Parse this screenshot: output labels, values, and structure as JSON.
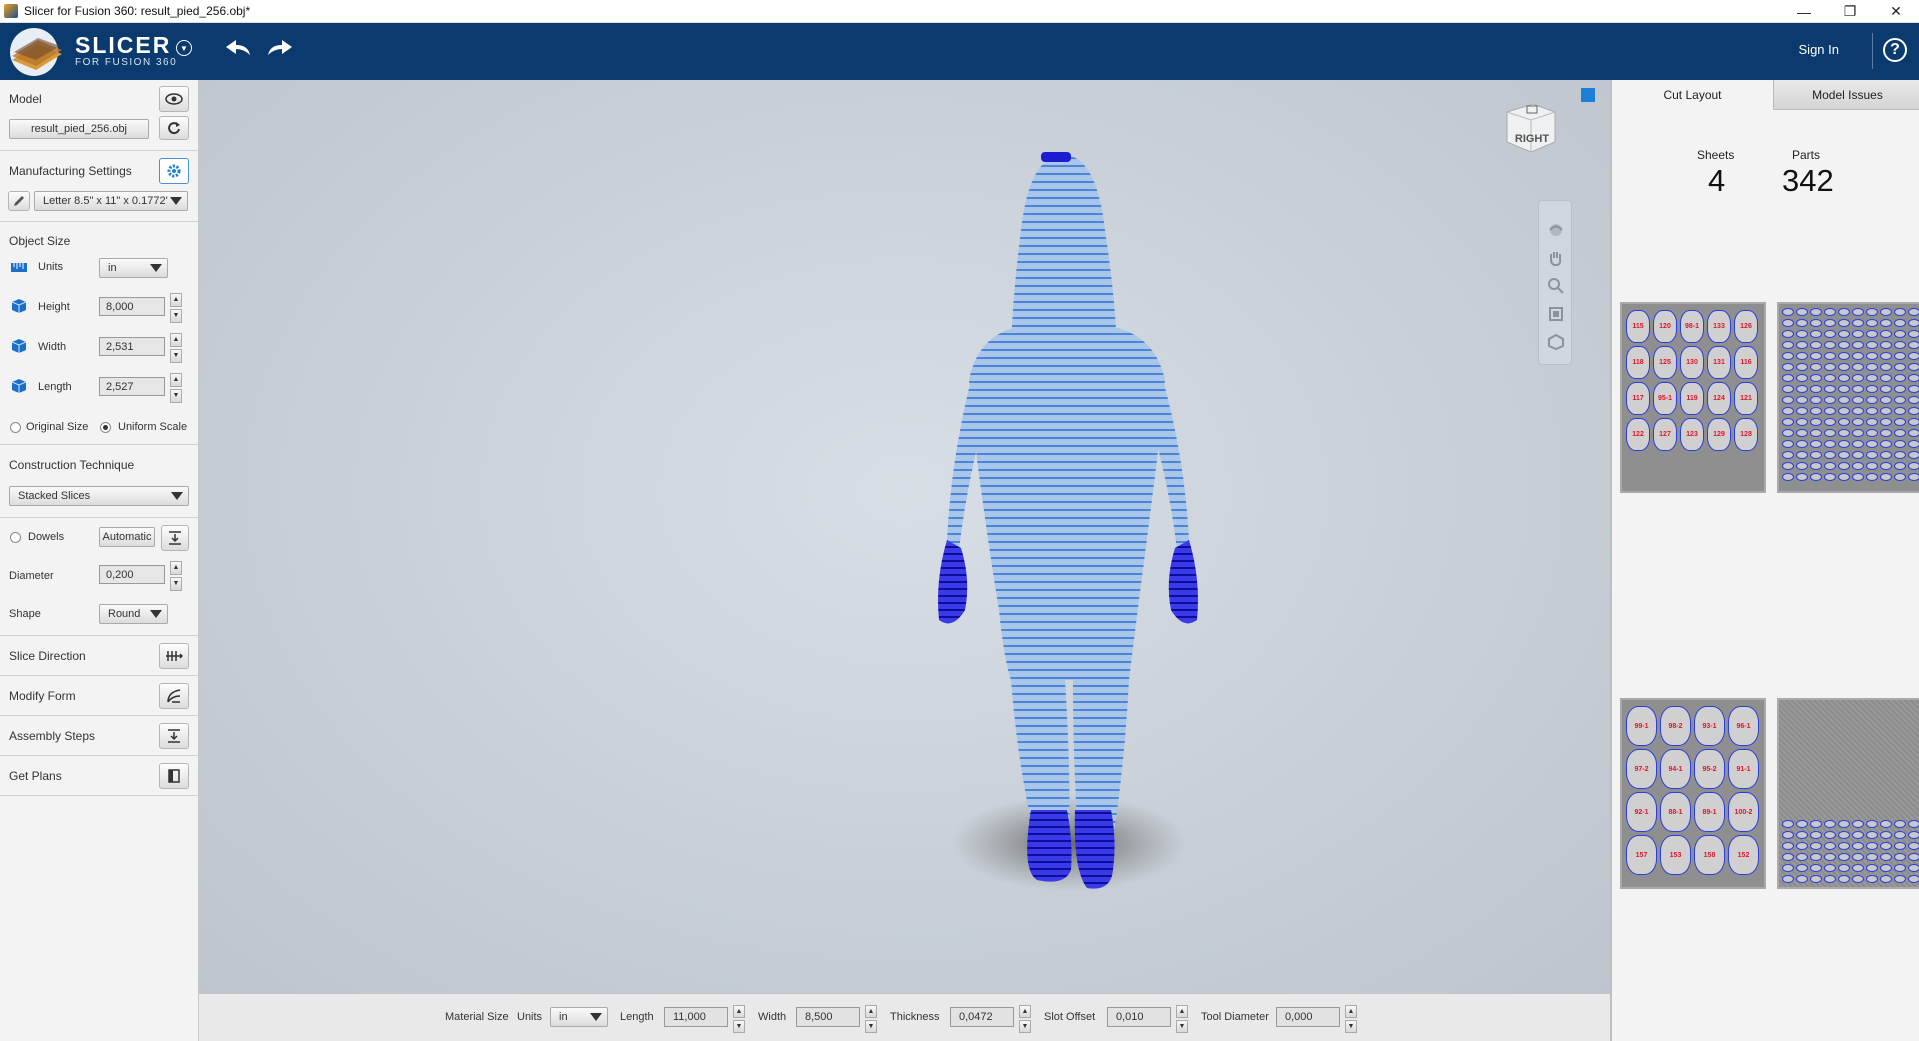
{
  "window": {
    "title": "Slicer for Fusion 360: result_pied_256.obj*",
    "min": "—",
    "max": "❐",
    "close": "✕"
  },
  "header": {
    "brand": "SLICER",
    "brand_sub": "FOR FUSION 360",
    "sign_in": "Sign In",
    "help": "?"
  },
  "left": {
    "model_label": "Model",
    "model_file": "result_pied_256.obj",
    "manufacturing_label": "Manufacturing Settings",
    "material_preset": "Letter 8.5\" x 11\" x 0.1772'",
    "object_size_label": "Object Size",
    "units_label": "Units",
    "units_value": "in",
    "height_label": "Height",
    "height_value": "8,000",
    "width_label": "Width",
    "width_value": "2,531",
    "length_label": "Length",
    "length_value": "2,527",
    "original_size": "Original Size",
    "uniform_scale": "Uniform Scale",
    "construction_label": "Construction Technique",
    "construction_value": "Stacked Slices",
    "dowels_label": "Dowels",
    "dowels_mode": "Automatic",
    "diameter_label": "Diameter",
    "diameter_value": "0,200",
    "shape_label": "Shape",
    "shape_value": "Round",
    "slice_direction": "Slice Direction",
    "modify_form": "Modify Form",
    "assembly_steps": "Assembly Steps",
    "get_plans": "Get Plans"
  },
  "viewport": {
    "viewcube_face": "RIGHT"
  },
  "bottom": {
    "material_size": "Material Size",
    "units_label": "Units",
    "units_value": "in",
    "length_label": "Length",
    "length_value": "11,000",
    "width_label": "Width",
    "width_value": "8,500",
    "thickness_label": "Thickness",
    "thickness_value": "0,0472",
    "slot_offset_label": "Slot Offset",
    "slot_offset_value": "0,010",
    "tool_diameter_label": "Tool Diameter",
    "tool_diameter_value": "0,000"
  },
  "right": {
    "tab_cut_layout": "Cut Layout",
    "tab_model_issues": "Model Issues",
    "sheets_label": "Sheets",
    "sheets_value": "4",
    "parts_label": "Parts",
    "parts_value": "342",
    "sheet1_labels": [
      "115",
      "120",
      "98-1",
      "133",
      "126",
      "118",
      "125",
      "130",
      "131",
      "116",
      "117",
      "95-1",
      "119",
      "124",
      "121",
      "122",
      "127",
      "123",
      "129",
      "128"
    ],
    "sheet3_labels": [
      "99-1",
      "98-2",
      "93-1",
      "96-1",
      "97-2",
      "94-1",
      "95-2",
      "91-1",
      "92-1",
      "88-1",
      "89-1",
      "100-2",
      "157",
      "153",
      "158",
      "152"
    ]
  },
  "colors": {
    "header_bg": "#0b3a6e",
    "accent": "#1e7fd6",
    "slice_blue": "#1a1ad0",
    "model_light": "#8fb4e4"
  }
}
